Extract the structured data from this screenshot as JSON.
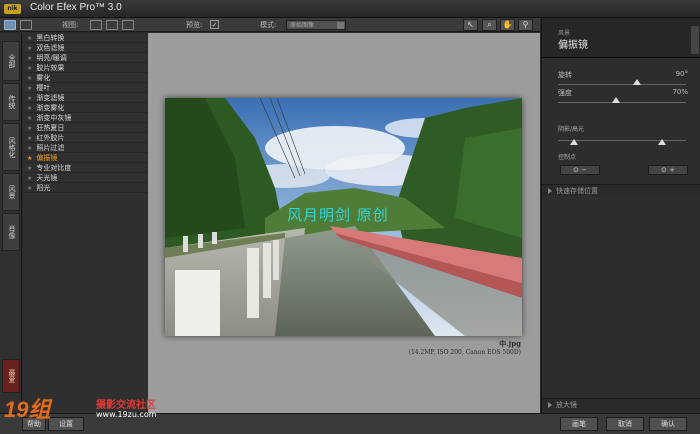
{
  "app": {
    "logo": "nik",
    "title": "Color Efex Pro™ 3.0"
  },
  "toolbar": {
    "view_label": "视图:",
    "preview_label": "预览:",
    "preview_checked": "✓",
    "mode_label": "模式:",
    "mode_value": "原始图像"
  },
  "left_tabs": [
    "全部",
    "传统",
    "风格化",
    "风景",
    "肖像",
    "最爱"
  ],
  "filters": [
    {
      "label": "黑白转换"
    },
    {
      "label": "双色滤镜"
    },
    {
      "label": "明亮/暖调"
    },
    {
      "label": "胶片效果"
    },
    {
      "label": "雾化"
    },
    {
      "label": "樱叶"
    },
    {
      "label": "渐变滤镜"
    },
    {
      "label": "渐变雾化"
    },
    {
      "label": "渐变中灰镜"
    },
    {
      "label": "狂热夏日"
    },
    {
      "label": "红外胶片"
    },
    {
      "label": "照片过滤"
    },
    {
      "label": "偏振镜",
      "selected": true
    },
    {
      "label": "专业对比度"
    },
    {
      "label": "天光镜"
    },
    {
      "label": "阳光"
    }
  ],
  "photo": {
    "overlay_text": "风月明剑 原创",
    "filename": "中.jpg",
    "meta": "(14.2MP, ISO 200, Canon EOS 500D)"
  },
  "filter_panel": {
    "category": "风景",
    "title": "偏振镜",
    "rotation": {
      "label": "旋转",
      "value": "90°",
      "fraction": 0.62
    },
    "strength": {
      "label": "强度",
      "value": "70%",
      "fraction": 0.45
    },
    "shadows_label": "阴影/高光",
    "control_points_label": "控制点",
    "quick_save": "快速存储位置",
    "loupe": "放大镜"
  },
  "bottom": {
    "help": "帮助",
    "settings": "设置",
    "brush": "画笔",
    "cancel": "取消",
    "ok": "确认"
  },
  "watermark": {
    "logo": "19组",
    "name": "摄影交流社区",
    "url": "www.19zu.com"
  },
  "colors": {
    "accent": "#f0a020",
    "panel": "#2d2d2d",
    "canvas": "#9c9c9c"
  }
}
